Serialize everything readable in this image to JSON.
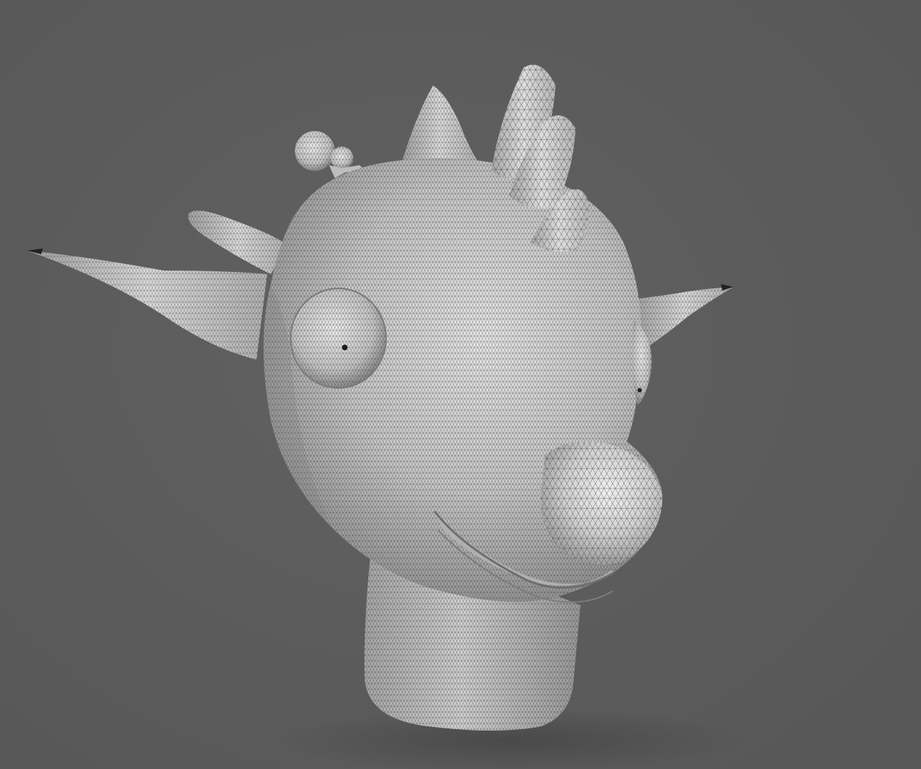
{
  "scene": {
    "subject_icon": "wireframe-creature-head",
    "background_color": "#5b5b5b",
    "surface_color": "#d8d8d8",
    "wire_color": "#3a3a3a"
  }
}
